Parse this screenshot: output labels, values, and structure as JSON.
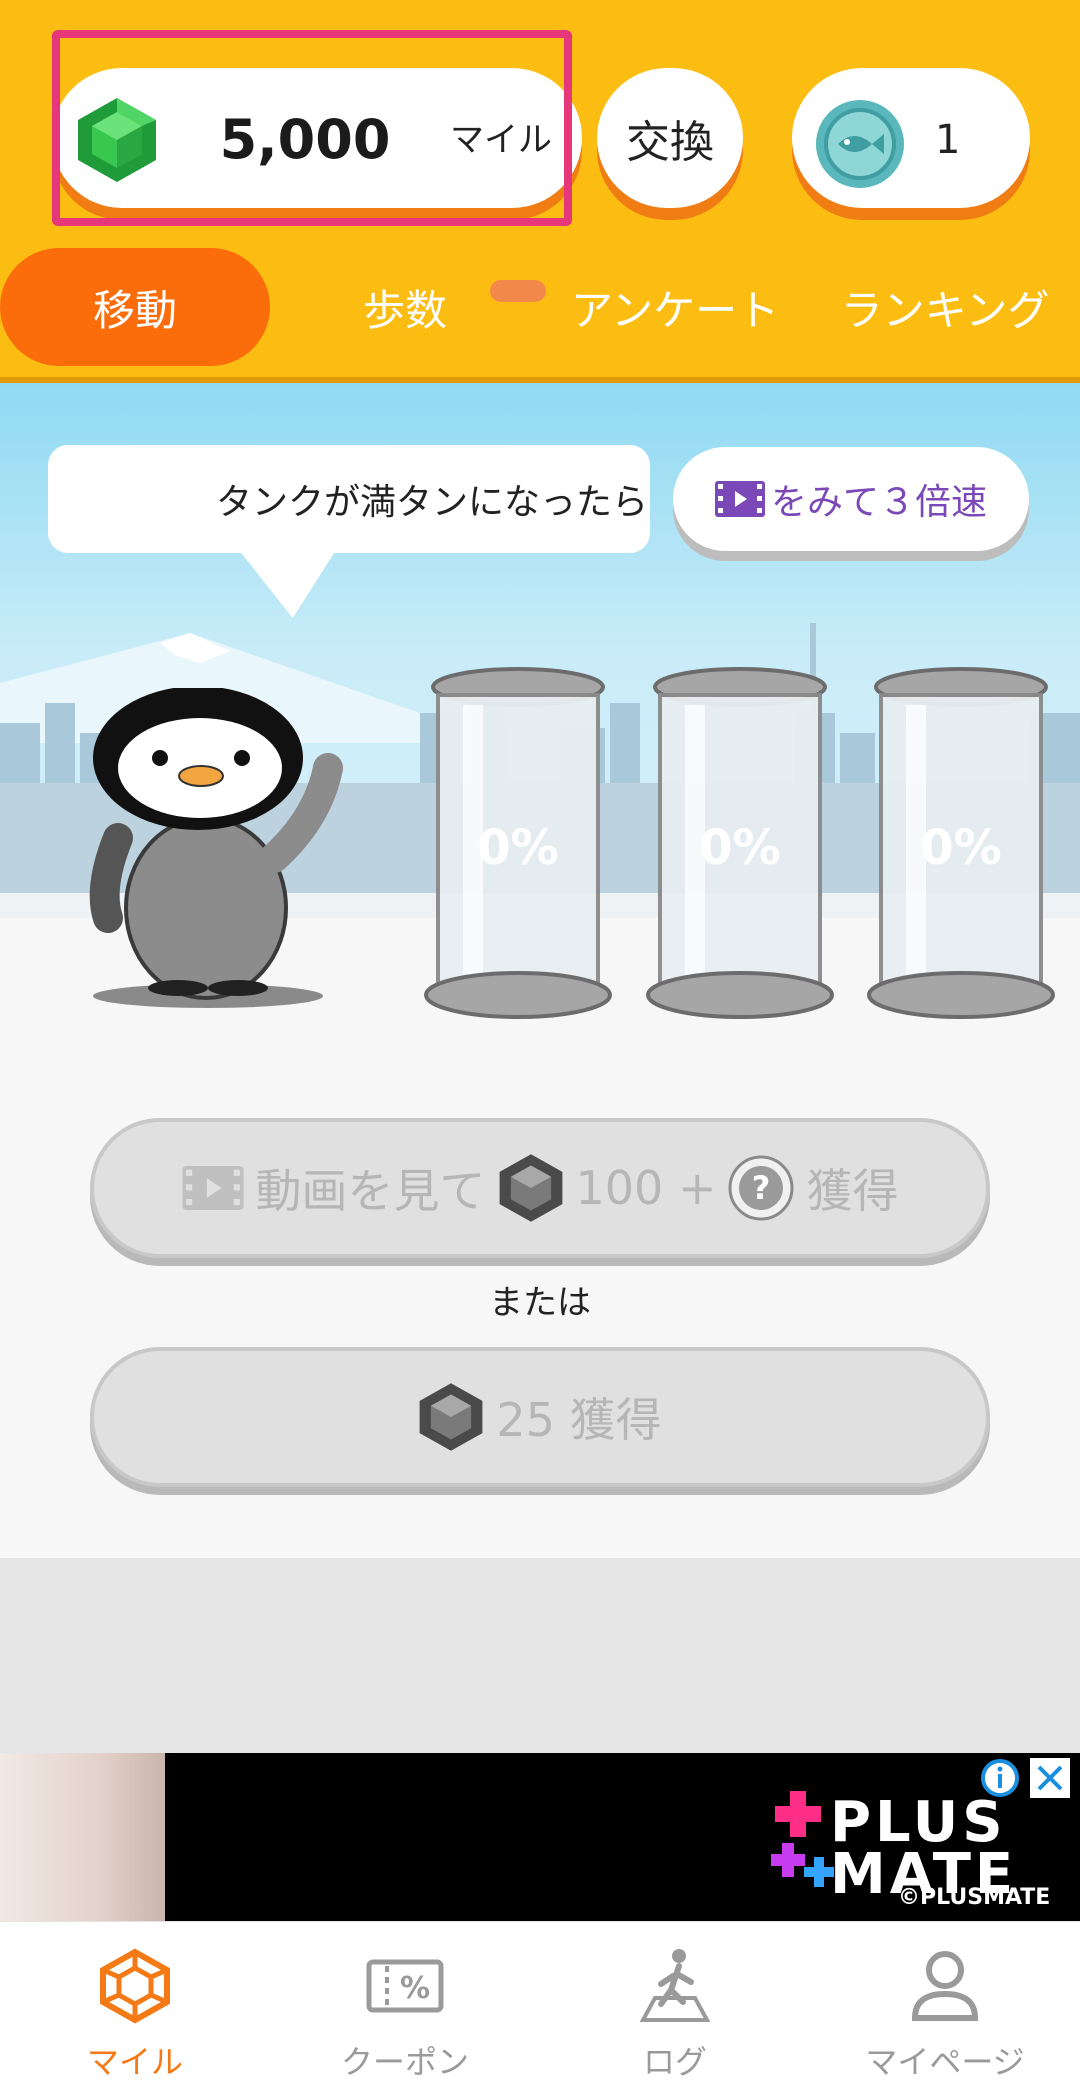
{
  "header": {
    "miles_value": "5,000",
    "miles_unit": "マイル",
    "exchange_label": "交換",
    "coin_count": "1"
  },
  "tabs": [
    {
      "label": "移動",
      "active": true
    },
    {
      "label": "歩数",
      "active": false
    },
    {
      "label": "アンケート",
      "active": false
    },
    {
      "label": "ランキング",
      "active": false
    }
  ],
  "scene": {
    "bubble_text": "タンクが満タンになったら",
    "video_x3_label": "をみて３倍速",
    "tanks": [
      {
        "label": "0%",
        "fill": 0
      },
      {
        "label": "0%",
        "fill": 0
      },
      {
        "label": "0%",
        "fill": 0
      }
    ]
  },
  "actions": {
    "watch_video_text": "動画を見て",
    "watch_video_amount": "100 +",
    "watch_video_get": "獲得",
    "or_text": "または",
    "get_amount": "25 獲得"
  },
  "ad": {
    "brand": "PLUS MATE",
    "copyright": "©PLUSMATE"
  },
  "bottom_nav": [
    {
      "label": "マイル",
      "icon": "hexagon-gem-icon",
      "active": true
    },
    {
      "label": "クーポン",
      "icon": "coupon-icon",
      "active": false
    },
    {
      "label": "ログ",
      "icon": "walking-person-icon",
      "active": false
    },
    {
      "label": "マイページ",
      "icon": "person-icon",
      "active": false
    }
  ],
  "colors": {
    "header_bg": "#fcbd13",
    "accent_orange": "#fb6c0b",
    "highlight_pink": "#e6377b",
    "video_purple": "#7b48b8"
  }
}
